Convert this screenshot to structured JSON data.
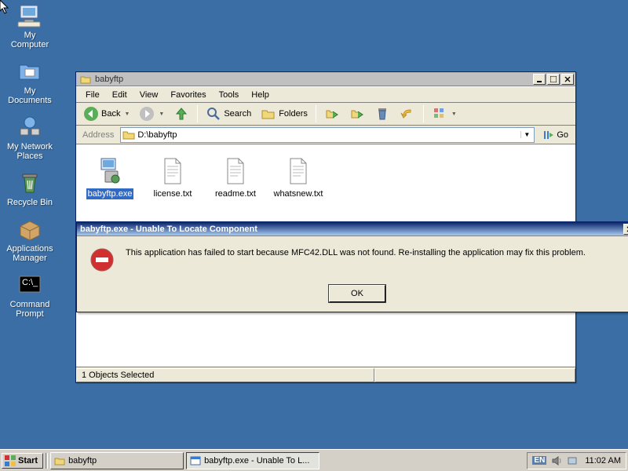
{
  "desktop": {
    "icons": [
      {
        "label": "My Computer",
        "icon": "computer"
      },
      {
        "label": "My Documents",
        "icon": "folder-docs"
      },
      {
        "label": "My Network Places",
        "icon": "network"
      },
      {
        "label": "Recycle Bin",
        "icon": "recycle"
      },
      {
        "label": "Applications Manager",
        "icon": "appmgr"
      },
      {
        "label": "Command Prompt",
        "icon": "cmd"
      }
    ]
  },
  "explorer": {
    "title": "babyftp",
    "menus": [
      "File",
      "Edit",
      "View",
      "Favorites",
      "Tools",
      "Help"
    ],
    "toolbar": {
      "back": "Back",
      "search": "Search",
      "folders": "Folders"
    },
    "address": {
      "label": "Address",
      "path": "D:\\babyftp",
      "go": "Go"
    },
    "files": [
      {
        "name": "babyftp.exe",
        "type": "exe",
        "selected": true
      },
      {
        "name": "license.txt",
        "type": "txt",
        "selected": false
      },
      {
        "name": "readme.txt",
        "type": "txt",
        "selected": false
      },
      {
        "name": "whatsnew.txt",
        "type": "txt",
        "selected": false
      }
    ],
    "status": "1 Objects Selected"
  },
  "dialog": {
    "title": "babyftp.exe - Unable To Locate Component",
    "message": "This application has failed to start because MFC42.DLL was not found. Re-installing the application may fix this problem.",
    "ok": "OK"
  },
  "taskbar": {
    "start": "Start",
    "tasks": [
      {
        "label": "babyftp",
        "icon": "folder",
        "active": false
      },
      {
        "label": "babyftp.exe - Unable To L...",
        "icon": "app",
        "active": true
      }
    ],
    "lang": "EN",
    "time": "11:02 AM"
  }
}
